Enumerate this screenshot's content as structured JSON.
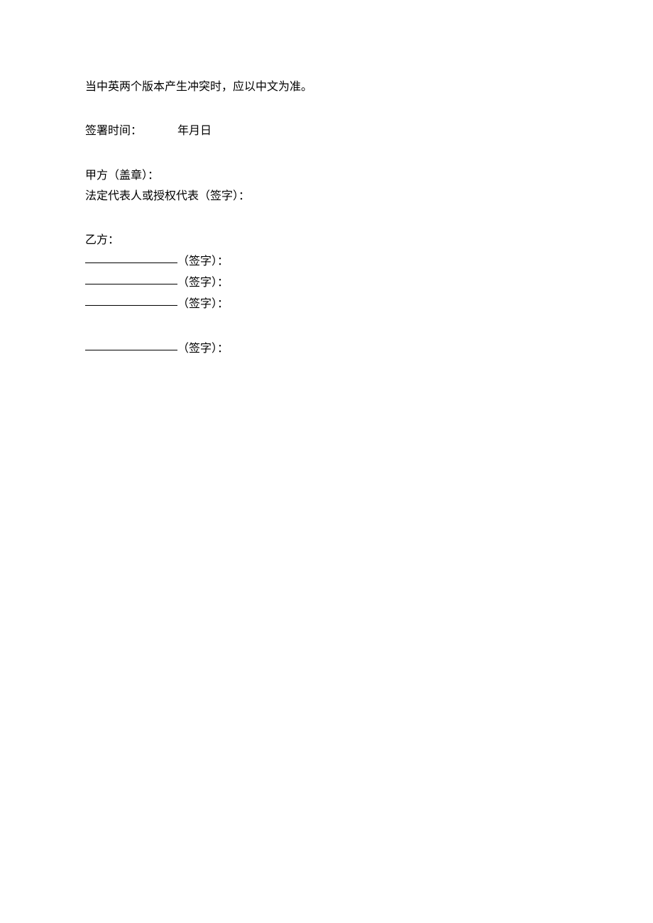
{
  "para1": "当中英两个版本产生冲突时，应以中文为准。",
  "signing": {
    "label": "签署时间：",
    "date_fmt": "年月日"
  },
  "partyA": {
    "seal": "甲方（盖章）：",
    "legal_rep": "法定代表人或授权代表（签字）："
  },
  "partyB": {
    "label": "乙方：",
    "sign_suffix": "（签字）：",
    "sign_suffix_alt": "（签字）："
  }
}
